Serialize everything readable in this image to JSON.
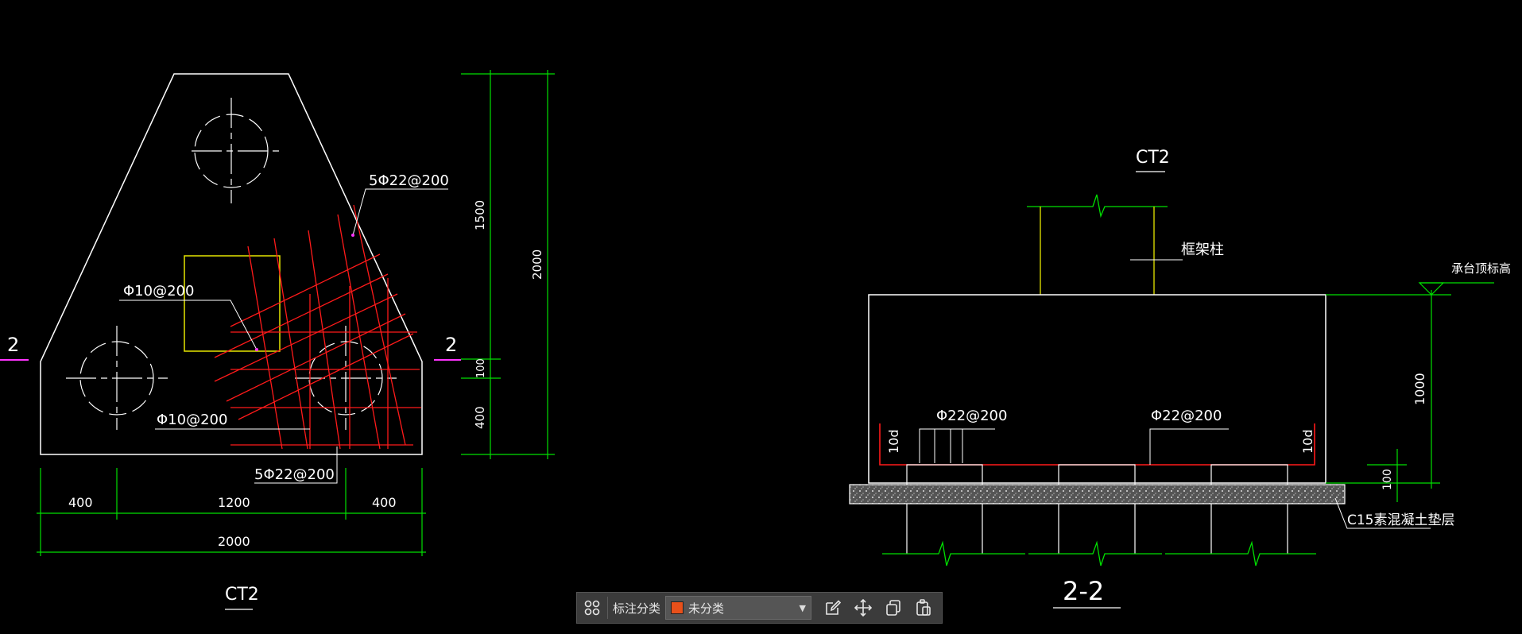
{
  "colors": {
    "background": "#000000",
    "outline": "#ffffff",
    "dimension": "#00e000",
    "rebar": "#ff1a1a",
    "column": "#e6e600",
    "section_marker": "#ff33ff",
    "accent_swatch": "#e8501a"
  },
  "plan": {
    "rebar_top_right": "5Φ22@200",
    "rebar_top_left": "Φ10@200",
    "rebar_bottom_left": "Φ10@200",
    "rebar_bottom": "5Φ22@200",
    "section_left": "2",
    "section_right": "2",
    "dims_bottom": [
      "400",
      "1200",
      "400"
    ],
    "dim_total": "2000",
    "dims_right": [
      "1500",
      "100",
      "400"
    ],
    "dim_right_total": "2000",
    "title": "CT2"
  },
  "section": {
    "cap_label": "CT2",
    "column_label": "框架柱",
    "top_elevation_label": "承台顶标高",
    "rebar_left": "Φ22@200",
    "rebar_right": "Φ22@200",
    "anchor_left": "10d",
    "anchor_right": "10d",
    "height_dim": "1000",
    "cushion_dim": "100",
    "cushion_label": "C15素混凝土垫层",
    "title": "2-2"
  },
  "toolbar": {
    "grid_icon": "grid-four-icon",
    "category_label": "标注分类",
    "category_value": "未分类",
    "actions": [
      "edit-icon",
      "move-icon",
      "copy-icon",
      "paste-icon"
    ]
  }
}
